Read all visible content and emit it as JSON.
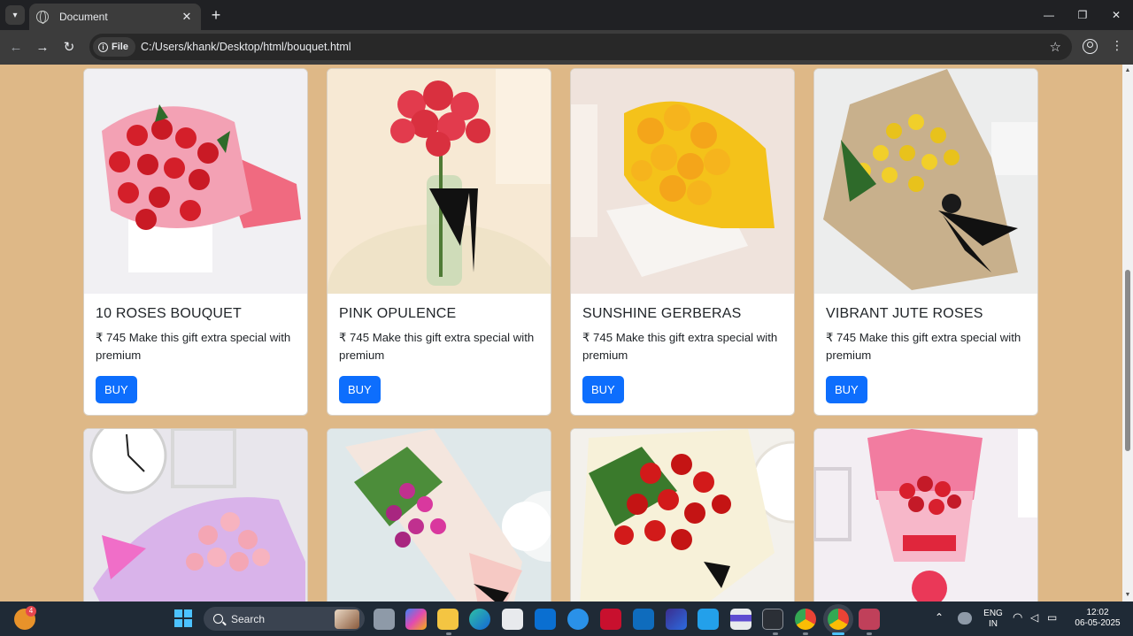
{
  "browser": {
    "tab_title": "Document",
    "new_tab_glyph": "+",
    "tab_close_glyph": "✕",
    "url_chip_label": "File",
    "url": "C:/Users/khank/Desktop/html/bouquet.html",
    "star_glyph": "☆",
    "menu_glyph": "⋮",
    "back_glyph": "←",
    "forward_glyph": "→",
    "reload_glyph": "↻",
    "minimize_glyph": "—",
    "maximize_glyph": "❐",
    "close_glyph": "✕"
  },
  "products": [
    {
      "name": "10 ROSES BOUQUET",
      "desc": "₹ 745 Make this gift extra special with premium",
      "button": "BUY",
      "image": "red-roses-pink-wrap-photo"
    },
    {
      "name": "PINK OPULENCE",
      "desc": "₹ 745 Make this gift extra special with premium",
      "button": "BUY",
      "image": "pink-carnations-vase-photo"
    },
    {
      "name": "SUNSHINE GERBERAS",
      "desc": "₹ 745 Make this gift extra special with premium",
      "button": "BUY",
      "image": "yellow-gerberas-photo"
    },
    {
      "name": "VIBRANT JUTE ROSES",
      "desc": "₹ 745 Make this gift extra special with premium",
      "button": "BUY",
      "image": "yellow-roses-jute-photo"
    },
    {
      "image": "pink-roses-clock-photo"
    },
    {
      "image": "purple-orchids-photo"
    },
    {
      "image": "red-roses-cream-wrap-photo"
    },
    {
      "image": "red-roses-pink-layered-photo"
    }
  ],
  "taskbar": {
    "search_label": "Search",
    "badge_count": "4",
    "language_line1": "ENG",
    "language_line2": "IN",
    "time": "12:02",
    "date": "06-05-2025"
  },
  "colors": {
    "page_background": "#deb887",
    "buy_button": "#0d6efd",
    "browser_frame": "#202124",
    "taskbar": "#1f2a36"
  }
}
